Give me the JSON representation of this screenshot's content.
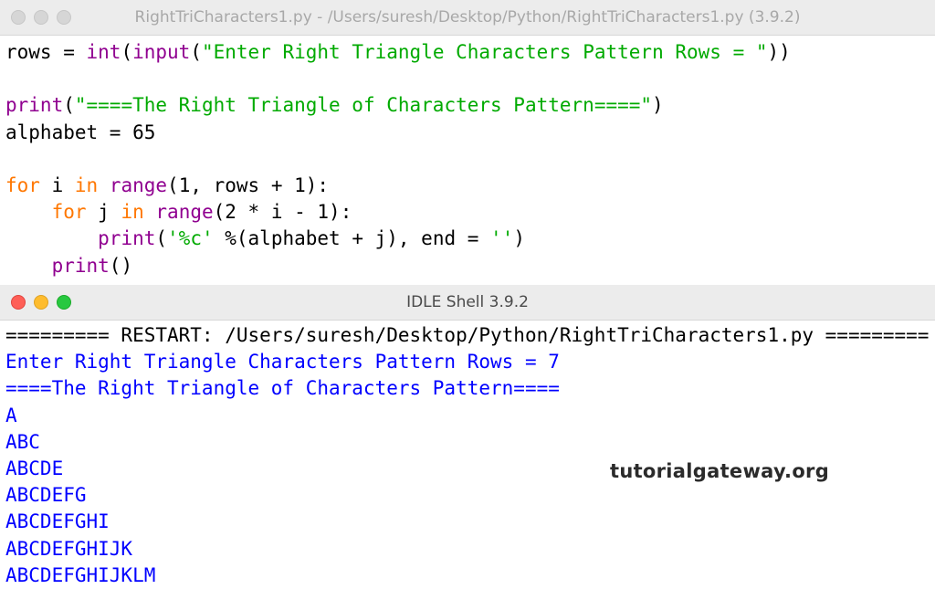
{
  "editor": {
    "title": "RightTriCharacters1.py - /Users/suresh/Desktop/Python/RightTriCharacters1.py (3.9.2)",
    "colors": {
      "keyword": "#ff7700",
      "builtin": "#900090",
      "string": "#00aa00"
    },
    "lines": [
      {
        "t1": "rows = ",
        "t2": "int",
        "t3": "(",
        "t4": "input",
        "t5": "(",
        "t6": "\"Enter Right Triangle Characters Pattern Rows = \"",
        "t7": "))"
      },
      {
        "blank": ""
      },
      {
        "t1": "print",
        "t2": "(",
        "t3": "\"====The Right Triangle of Characters Pattern====\"",
        "t4": ")"
      },
      {
        "t1": "alphabet = 65"
      },
      {
        "blank": ""
      },
      {
        "t1": "for",
        "t2": " i ",
        "t3": "in",
        "t4": " ",
        "t5": "range",
        "t6": "(1, rows + 1):"
      },
      {
        "t1": "    ",
        "t2": "for",
        "t3": " j ",
        "t4": "in",
        "t5": " ",
        "t6": "range",
        "t7": "(2 * i - 1):"
      },
      {
        "t1": "        ",
        "t2": "print",
        "t3": "(",
        "t4": "'%c'",
        "t5": " %(alphabet + j), end = ",
        "t6": "''",
        "t7": ")"
      },
      {
        "t1": "    ",
        "t2": "print",
        "t3": "()"
      }
    ]
  },
  "shell": {
    "title": "IDLE Shell 3.9.2",
    "colors": {
      "output": "#0000ff"
    },
    "restart_line": "========= RESTART: /Users/suresh/Desktop/Python/RightTriCharacters1.py =========",
    "prompt_line": "Enter Right Triangle Characters Pattern Rows = 7",
    "header_line": "====The Right Triangle of Characters Pattern====",
    "output_lines": [
      "A",
      "ABC",
      "ABCDE",
      "ABCDEFG",
      "ABCDEFGHI",
      "ABCDEFGHIJK",
      "ABCDEFGHIJKLM"
    ]
  },
  "watermark": "tutorialgateway.org"
}
